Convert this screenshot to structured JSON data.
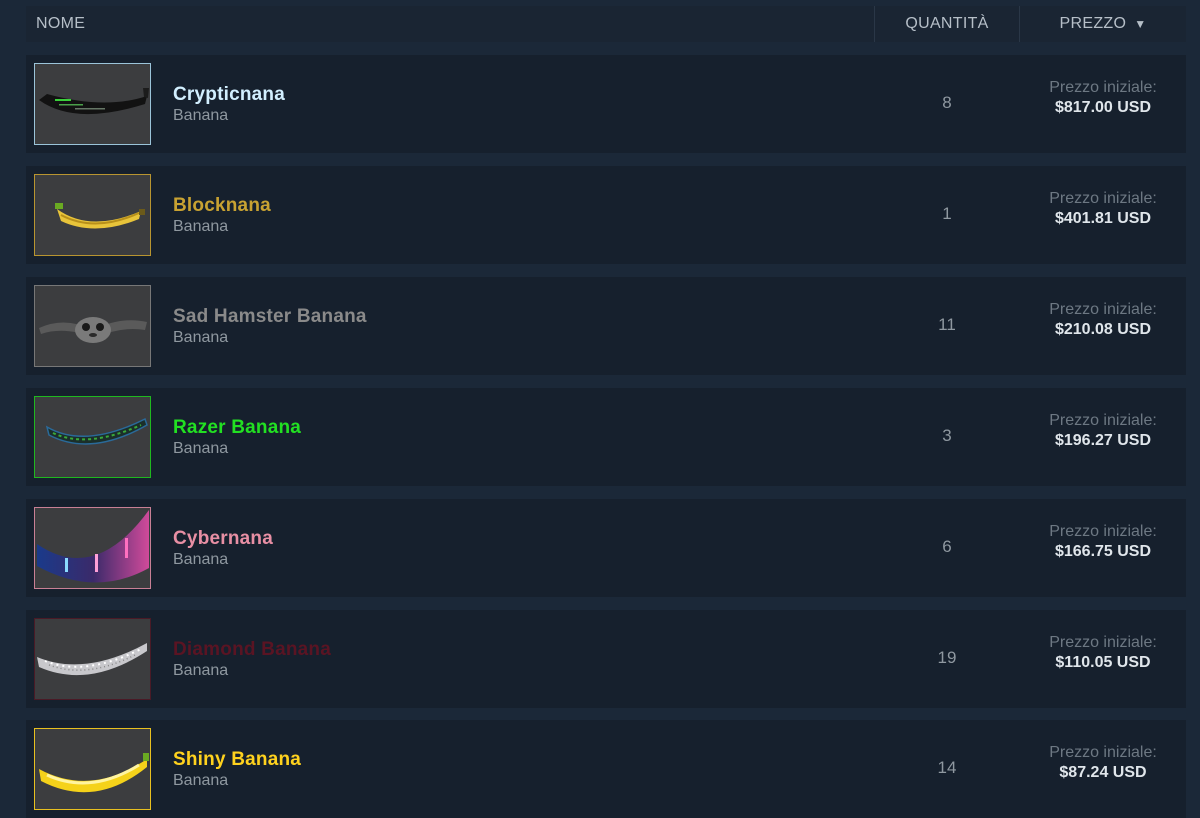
{
  "header": {
    "name": "NOME",
    "quantity": "QUANTITÀ",
    "price": "PREZZO",
    "sort_icon": "caret-down-icon"
  },
  "items": [
    {
      "name": "Crypticnana",
      "type": "Banana",
      "quantity": "8",
      "price_label": "Prezzo iniziale:",
      "price": "$817.00 USD",
      "name_color": "#d2efff",
      "border_color": "#9bc4d9"
    },
    {
      "name": "Blocknana",
      "type": "Banana",
      "quantity": "1",
      "price_label": "Prezzo iniziale:",
      "price": "$401.81 USD",
      "name_color": "#c8a232",
      "border_color": "#b89530"
    },
    {
      "name": "Sad Hamster Banana",
      "type": "Banana",
      "quantity": "11",
      "price_label": "Prezzo iniziale:",
      "price": "$210.08 USD",
      "name_color": "#8a8a8a",
      "border_color": "#777777"
    },
    {
      "name": "Razer Banana",
      "type": "Banana",
      "quantity": "3",
      "price_label": "Prezzo iniziale:",
      "price": "$196.27 USD",
      "name_color": "#22e022",
      "border_color": "#1fb81f"
    },
    {
      "name": "Cybernana",
      "type": "Banana",
      "quantity": "6",
      "price_label": "Prezzo iniziale:",
      "price": "$166.75 USD",
      "name_color": "#e88fa4",
      "border_color": "#c98095"
    },
    {
      "name": "Diamond Banana",
      "type": "Banana",
      "quantity": "19",
      "price_label": "Prezzo iniziale:",
      "price": "$110.05 USD",
      "name_color": "#5a1423",
      "border_color": "#4a1a26"
    },
    {
      "name": "Shiny Banana",
      "type": "Banana",
      "quantity": "14",
      "price_label": "Prezzo iniziale:",
      "price": "$87.24 USD",
      "name_color": "#ffd21e",
      "border_color": "#e8c020"
    }
  ]
}
